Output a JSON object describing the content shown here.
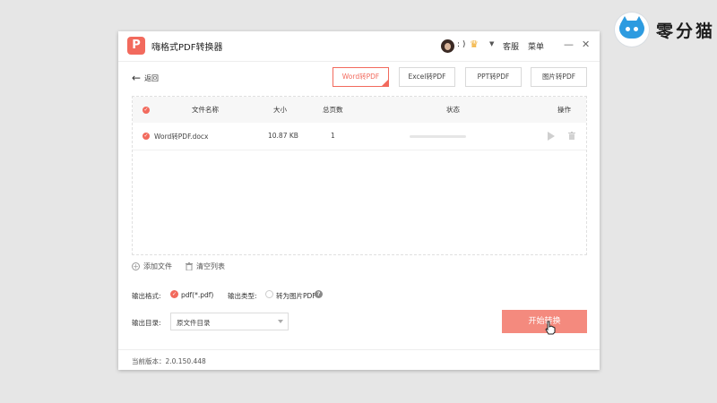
{
  "watermark": {
    "text": "零分猫"
  },
  "window": {
    "title": "嗨格式PDF转换器",
    "logo_letter": "P",
    "user": {
      "name": ": )"
    },
    "service_label": "客服",
    "menu_label": "菜单",
    "minimize_glyph": "—",
    "close_glyph": "✕"
  },
  "toolbar": {
    "back_label": "返回",
    "modes": [
      "Word转PDF",
      "Excel转PDF",
      "PPT转PDF",
      "图片转PDF"
    ],
    "active_mode": "Word转PDF"
  },
  "table": {
    "headers": {
      "name": "文件名称",
      "size": "大小",
      "pages": "总页数",
      "status": "状态",
      "actions": "操作"
    },
    "rows": [
      {
        "checked": true,
        "name": "Word转PDF.docx",
        "size": "10.87 KB",
        "pages": "1",
        "progress": 0
      }
    ]
  },
  "list_actions": {
    "add_file": "添加文件",
    "clear_list": "清空列表"
  },
  "settings": {
    "output_format_label": "输出格式:",
    "output_format_value": "pdf(*.pdf)",
    "output_type_label": "输出类型:",
    "output_type_option": "转为图片PDF",
    "output_dir_label": "输出目录:",
    "output_dir_value": "原文件目录"
  },
  "start_button": {
    "label": "开始转换"
  },
  "footer": {
    "version": "当前版本：2.0.150.448"
  },
  "colors": {
    "accent": "#f26a5d",
    "start_button": "#f48a7e"
  }
}
